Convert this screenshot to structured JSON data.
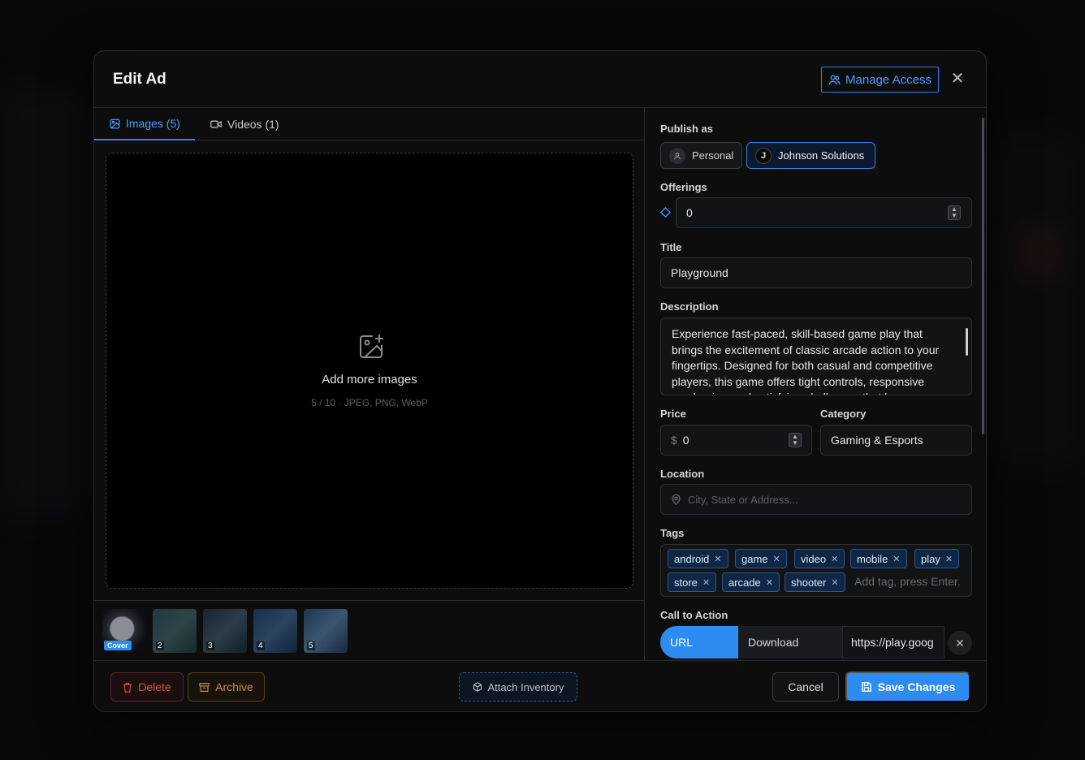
{
  "modal": {
    "title": "Edit Ad",
    "manage_access_label": "Manage Access",
    "close_icon": "close-icon"
  },
  "media": {
    "tabs": [
      {
        "label": "Images (5)",
        "icon": "image-icon",
        "active": true
      },
      {
        "label": "Videos (1)",
        "icon": "video-icon",
        "active": false
      }
    ],
    "dropzone": {
      "title": "Add more images",
      "subtitle": "5 / 10 · JPEG, PNG, WebP",
      "icon": "image-plus-icon"
    },
    "thumbnails": [
      {
        "label": "Cover",
        "colors": [
          "#1b1c25",
          "#8a3b3b"
        ]
      },
      {
        "label": "2",
        "colors": [
          "#1f3a40",
          "#2b3d3f"
        ]
      },
      {
        "label": "3",
        "colors": [
          "#1d2d3a",
          "#3a4a55"
        ]
      },
      {
        "label": "4",
        "colors": [
          "#18304a",
          "#2a4360"
        ]
      },
      {
        "label": "5",
        "colors": [
          "#1f3550",
          "#3c5670"
        ]
      }
    ]
  },
  "form": {
    "publish_as": {
      "label": "Publish as",
      "options": [
        {
          "label": "Personal",
          "active": false
        },
        {
          "label": "Johnson Solutions",
          "active": true
        }
      ]
    },
    "offerings": {
      "label": "Offerings",
      "value": "0",
      "icon": "diamond-icon"
    },
    "title": {
      "label": "Title",
      "value": "Playground"
    },
    "description": {
      "label": "Description",
      "value": "Experience fast-paced, skill-based game play that brings the excitement of classic arcade action to your fingertips. Designed for both casual and competitive players, this game offers tight controls, responsive mechanics, and satisfying challenges that keep"
    },
    "price": {
      "label": "Price",
      "currency": "$",
      "value": "0"
    },
    "category": {
      "label": "Category",
      "value": "Gaming & Esports"
    },
    "location": {
      "label": "Location",
      "placeholder": "City, State or Address...",
      "icon": "map-pin-icon"
    },
    "tags": {
      "label": "Tags",
      "items": [
        "android",
        "game",
        "video",
        "mobile",
        "play",
        "store",
        "arcade",
        "shooter"
      ],
      "placeholder": "Add tag, press Enter."
    },
    "cta": {
      "label": "Call to Action",
      "options": [
        "URL",
        "Download"
      ],
      "selected": "URL",
      "value": "https://play.goog"
    }
  },
  "footer": {
    "delete_label": "Delete",
    "archive_label": "Archive",
    "attach_label": "Attach Inventory",
    "cancel_label": "Cancel",
    "save_label": "Save Changes"
  },
  "colors": {
    "accent": "#2d8cf0",
    "danger": "#d9534f",
    "warning": "#d08a4a"
  }
}
